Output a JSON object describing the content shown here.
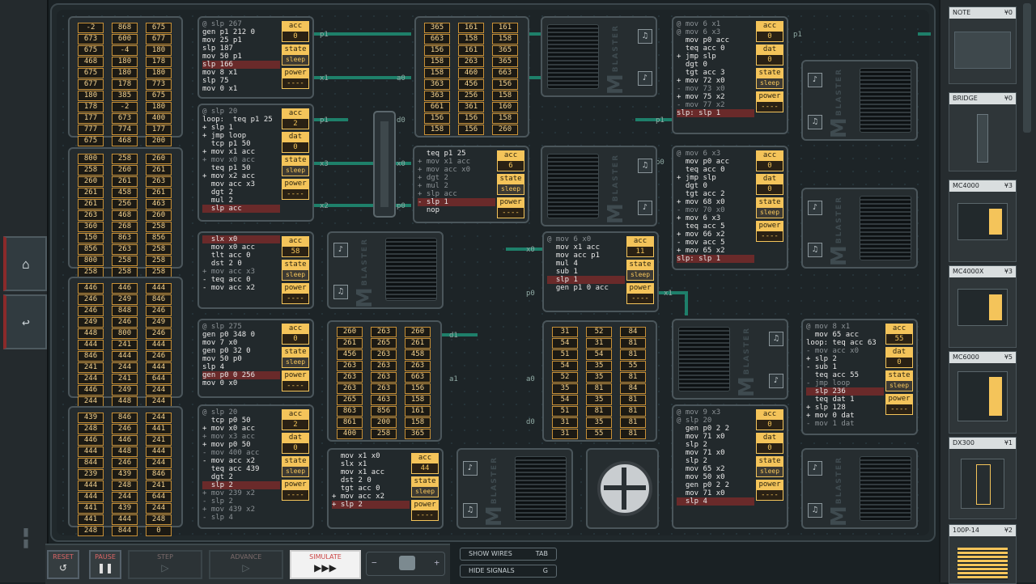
{
  "toolbar": {
    "reset_label": "RESET",
    "pause_label": "PAUSE",
    "step_label": "STEP",
    "advance_label": "ADVANCE",
    "simulate_label": "SIMULATE",
    "minus": "−",
    "plus": "+",
    "show_wires": "SHOW WIRES",
    "show_wires_key": "TAB",
    "hide_signals": "HIDE SIGNALS",
    "hide_signals_key": "G"
  },
  "parts": [
    {
      "name": "NOTE",
      "price": "¥0"
    },
    {
      "name": "BRIDGE",
      "price": "¥0"
    },
    {
      "name": "MC4000",
      "price": "¥3"
    },
    {
      "name": "MC4000X",
      "price": "¥3"
    },
    {
      "name": "MC6000",
      "price": "¥5"
    },
    {
      "name": "DX300",
      "price": "¥1"
    },
    {
      "name": "100P-14",
      "price": "¥2"
    }
  ],
  "fm": {
    "big": "FM",
    "small": "BLASTER"
  },
  "wire_labels": {
    "p1a": "p1",
    "x1a": "x1",
    "a0a": "a0",
    "p1b": "p1",
    "d0": "d0",
    "p1c": "p1",
    "x3": "x3",
    "x0a": "x0",
    "x2": "x2",
    "p0a": "p0",
    "p0b": "p0",
    "x0b": "x0",
    "p0c": "p0",
    "x1b": "x1",
    "d1": "d1",
    "a1": "a1",
    "a0b": "a0",
    "d0b": "d0",
    "p1d": "p1"
  },
  "mcs": [
    {
      "id": "mc1",
      "code": [
        [
          "@ slp 267",
          "c"
        ],
        [
          "gen p1 212 0",
          ""
        ],
        [
          "mov 25 p1",
          ""
        ],
        [
          "slp 187",
          ""
        ],
        [
          "mov 50 p1",
          ""
        ],
        [
          "slp 166",
          "hl"
        ],
        [
          "mov 8 x1",
          ""
        ],
        [
          "slp 75",
          ""
        ],
        [
          "mov 0 x1",
          ""
        ]
      ],
      "acc": "0",
      "dat": null,
      "state": "sleep",
      "power": "----"
    },
    {
      "id": "mc2",
      "code": [
        [
          "@ slp 20",
          "c"
        ],
        [
          "loop:  teq p1 25",
          ""
        ],
        [
          "+ slp 1",
          ""
        ],
        [
          "+ jmp loop",
          ""
        ],
        [
          "  tcp p1 50",
          ""
        ],
        [
          "+ mov x1 acc",
          ""
        ],
        [
          "+ mov x0 acc",
          "c"
        ],
        [
          "  teq p1 50",
          ""
        ],
        [
          "+ mov x2 acc",
          ""
        ],
        [
          "  mov acc x3",
          ""
        ],
        [
          "  dgt 2",
          ""
        ],
        [
          "  mul 2",
          ""
        ],
        [
          "  slp acc",
          "hl"
        ]
      ],
      "acc": "2",
      "dat": "0",
      "state": "sleep",
      "power": "----"
    },
    {
      "id": "mc3",
      "code": [
        [
          "  slx x0",
          "hl"
        ],
        [
          "  mov x0 acc",
          ""
        ],
        [
          "  tlt acc 0",
          ""
        ],
        [
          "  dst 2 0",
          ""
        ],
        [
          "+ mov acc x3",
          "c"
        ],
        [
          "- teq acc 0",
          ""
        ],
        [
          "- mov acc x2",
          ""
        ]
      ],
      "acc": "58",
      "dat": null,
      "state": "sleep",
      "power": "----"
    },
    {
      "id": "mc4",
      "code": [
        [
          "@ slp 275",
          "c"
        ],
        [
          "gen p0 348 0",
          ""
        ],
        [
          "mov 7 x0",
          ""
        ],
        [
          "gen p0 32 0",
          ""
        ],
        [
          "mov 50 p0",
          ""
        ],
        [
          "slp 4",
          ""
        ],
        [
          "gen p0 0 256",
          "hl"
        ],
        [
          "mov 0 x0",
          ""
        ]
      ],
      "acc": "0",
      "dat": null,
      "state": "sleep",
      "power": "----"
    },
    {
      "id": "mc5",
      "code": [
        [
          "@ slp 20",
          "c"
        ],
        [
          "  tcp p0 50",
          ""
        ],
        [
          "+ mov x0 acc",
          ""
        ],
        [
          "+ mov x3 acc",
          "c"
        ],
        [
          "+ mov p0 50",
          ""
        ],
        [
          "- mov 400 acc",
          "c"
        ],
        [
          "- mov acc x2",
          ""
        ],
        [
          "  teq acc 439",
          ""
        ],
        [
          "  dgt 2",
          ""
        ],
        [
          "  slp 2",
          "hl"
        ],
        [
          "+ mov 239 x2",
          "c"
        ],
        [
          "- slp 2",
          "c"
        ],
        [
          "+ mov 439 x2",
          "c"
        ],
        [
          "- slp 4",
          "c"
        ]
      ],
      "acc": "2",
      "dat": "0",
      "state": "sleep",
      "power": "----"
    },
    {
      "id": "mc6",
      "code": [
        [
          "  teq p1 25",
          ""
        ],
        [
          "+ mov x1 acc",
          "c"
        ],
        [
          "+ mov acc x0",
          "c"
        ],
        [
          "+ dgt 2",
          "c"
        ],
        [
          "+ mul 2",
          "c"
        ],
        [
          "+ slp acc",
          "c"
        ],
        [
          "- slp 1",
          "hl"
        ],
        [
          "  nop",
          ""
        ]
      ],
      "acc": "6",
      "dat": null,
      "state": "sleep",
      "power": "----"
    },
    {
      "id": "mc7",
      "code": [
        [
          "  mov x1 x0",
          ""
        ],
        [
          "  slx x1",
          ""
        ],
        [
          "  mov x1 acc",
          ""
        ],
        [
          "  dst 2 0",
          ""
        ],
        [
          "  tgt acc 0",
          ""
        ],
        [
          "+ mov acc x2",
          ""
        ],
        [
          "+ slp 2",
          "hl"
        ]
      ],
      "acc": "44",
      "dat": null,
      "state": "sleep",
      "power": "----"
    },
    {
      "id": "mc8",
      "code": [
        [
          "@ mov 6 x0",
          "c"
        ],
        [
          "  mov x1 acc",
          ""
        ],
        [
          "  mov acc p1",
          ""
        ],
        [
          "  mul 4",
          ""
        ],
        [
          "  sub 1",
          ""
        ],
        [
          "  slp 1",
          "hl"
        ],
        [
          "  gen p1 0 acc",
          ""
        ]
      ],
      "acc": "11",
      "dat": null,
      "state": "sleep",
      "power": "----"
    },
    {
      "id": "mc9",
      "code": [
        [
          "@ mov 6 x1",
          "c"
        ],
        [
          "@ mov 6 x3",
          "c"
        ],
        [
          "  mov p0 acc",
          ""
        ],
        [
          "  teq acc 0",
          ""
        ],
        [
          "+ jmp slp",
          ""
        ],
        [
          "  dgt 0",
          ""
        ],
        [
          "  tgt acc 3",
          ""
        ],
        [
          "+ mov 72 x0",
          ""
        ],
        [
          "- mov 73 x0",
          "c"
        ],
        [
          "+ mov 75 x2",
          ""
        ],
        [
          "- mov 77 x2",
          "c"
        ],
        [
          "slp: slp 1",
          "hl"
        ]
      ],
      "acc": "0",
      "dat": "0",
      "state": "sleep",
      "power": "----"
    },
    {
      "id": "mc10",
      "code": [
        [
          "@ mov 6 x3",
          "c"
        ],
        [
          "  mov p0 acc",
          ""
        ],
        [
          "  teq acc 0",
          ""
        ],
        [
          "+ jmp slp",
          ""
        ],
        [
          "  dgt 0",
          ""
        ],
        [
          "  tgt acc 2",
          ""
        ],
        [
          "+ mov 68 x0",
          ""
        ],
        [
          "- mov 70 x0",
          "c"
        ],
        [
          "+ mov 6 x3",
          ""
        ],
        [
          "  teq acc 5",
          ""
        ],
        [
          "+ mov 66 x2",
          ""
        ],
        [
          "- mov acc 5",
          ""
        ],
        [
          "+ mov 65 x2",
          ""
        ],
        [
          "slp: slp 1",
          "hl"
        ]
      ],
      "acc": "0",
      "dat": "0",
      "state": "sleep",
      "power": "----"
    },
    {
      "id": "mc11",
      "code": [
        [
          "@ mov 8 x1",
          "c"
        ],
        [
          "  mov 65 acc",
          ""
        ],
        [
          "loop: teq acc 63",
          ""
        ],
        [
          "- mov acc x0",
          "c"
        ],
        [
          "+ slp 2",
          ""
        ],
        [
          "- sub 1",
          ""
        ],
        [
          "  teq acc 55",
          ""
        ],
        [
          "- jmp loop",
          "c"
        ],
        [
          "  slp 236",
          "hl"
        ],
        [
          "  teq dat 1",
          ""
        ],
        [
          "+ slp 128",
          ""
        ],
        [
          "+ mov 0 dat",
          ""
        ],
        [
          "- mov 1 dat",
          "c"
        ]
      ],
      "acc": "55",
      "dat": "0",
      "state": "sleep",
      "power": "----"
    },
    {
      "id": "mc12",
      "code": [
        [
          "@ mov 9 x3",
          "c"
        ],
        [
          "@ slp 20",
          "c"
        ],
        [
          "  gen p0 2 2",
          ""
        ],
        [
          "  mov 71 x0",
          ""
        ],
        [
          "  slp 2",
          ""
        ],
        [
          "  mov 71 x0",
          ""
        ],
        [
          "  slp 2",
          ""
        ],
        [
          "  mov 65 x2",
          ""
        ],
        [
          "  mov 50 x0",
          ""
        ],
        [
          "  gen p0 2 2",
          ""
        ],
        [
          "  mov 71 x0",
          ""
        ],
        [
          "  slp 4",
          "hl"
        ]
      ],
      "acc": "0",
      "dat": "0",
      "state": "sleep",
      "power": "----"
    }
  ],
  "rams": [
    {
      "id": "ram1",
      "cols": [
        [
          "-2",
          "673",
          "675",
          "468",
          "675",
          "677",
          "180",
          "178",
          "177",
          "777",
          "675"
        ],
        [
          "868",
          "600",
          "-4",
          "180",
          "180",
          "178",
          "385",
          "-2",
          "673",
          "774",
          "468"
        ],
        [
          "675",
          "677",
          "180",
          "178",
          "180",
          "773",
          "675",
          "180",
          "400",
          "177",
          "200"
        ]
      ]
    },
    {
      "id": "ram2",
      "cols": [
        [
          "800",
          "258",
          "260",
          "261",
          "261",
          "263",
          "360",
          "150",
          "856",
          "800",
          "258"
        ],
        [
          "258",
          "260",
          "261",
          "458",
          "256",
          "468",
          "268",
          "863",
          "263",
          "258",
          "258"
        ],
        [
          "260",
          "261",
          "263",
          "261",
          "463",
          "260",
          "258",
          "856",
          "258",
          "258",
          "258"
        ]
      ]
    },
    {
      "id": "ram3",
      "cols": [
        [
          "446",
          "246",
          "246",
          "249",
          "448",
          "444",
          "846",
          "241",
          "244",
          "446",
          "244"
        ],
        [
          "446",
          "249",
          "848",
          "246",
          "800",
          "241",
          "444",
          "244",
          "241",
          "249",
          "448"
        ],
        [
          "444",
          "846",
          "246",
          "249",
          "246",
          "444",
          "246",
          "444",
          "644",
          "244",
          "244"
        ]
      ]
    },
    {
      "id": "ram4",
      "cols": [
        [
          "439",
          "248",
          "446",
          "444",
          "844",
          "239",
          "444",
          "444",
          "441",
          "441",
          "248"
        ],
        [
          "846",
          "246",
          "446",
          "448",
          "246",
          "439",
          "248",
          "244",
          "439",
          "444",
          "844"
        ],
        [
          "244",
          "441",
          "241",
          "444",
          "244",
          "846",
          "241",
          "644",
          "244",
          "248",
          "0"
        ]
      ]
    },
    {
      "id": "ram5",
      "cols": [
        [
          "365",
          "663",
          "156",
          "158",
          "158",
          "363",
          "363",
          "661",
          "156",
          "158"
        ],
        [
          "161",
          "158",
          "161",
          "263",
          "460",
          "456",
          "256",
          "361",
          "156",
          "156"
        ],
        [
          "161",
          "158",
          "365",
          "365",
          "663",
          "156",
          "158",
          "160",
          "158",
          "260"
        ]
      ]
    },
    {
      "id": "ram6",
      "cols": [
        [
          "260",
          "261",
          "456",
          "263",
          "263",
          "263",
          "265",
          "863",
          "861",
          "400"
        ],
        [
          "263",
          "265",
          "263",
          "263",
          "263",
          "263",
          "463",
          "856",
          "200",
          "258"
        ],
        [
          "260",
          "261",
          "458",
          "263",
          "663",
          "156",
          "158",
          "161",
          "158",
          "365"
        ]
      ]
    },
    {
      "id": "ram7",
      "cols": [
        [
          "31",
          "54",
          "51",
          "54",
          "52",
          "35",
          "54",
          "51",
          "31",
          "31"
        ],
        [
          "52",
          "31",
          "54",
          "35",
          "35",
          "81",
          "35",
          "81",
          "35",
          "55"
        ],
        [
          "84",
          "81",
          "81",
          "55",
          "81",
          "84",
          "81",
          "81",
          "81",
          "81"
        ]
      ]
    }
  ]
}
